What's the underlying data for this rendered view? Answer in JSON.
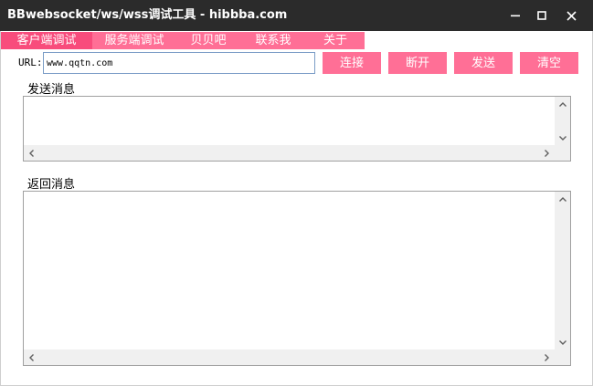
{
  "window": {
    "title": "BBwebsocket/ws/wss调试工具 - hibbba.com"
  },
  "tabs": [
    {
      "label": "客户端调试",
      "active": true
    },
    {
      "label": "服务端调试",
      "active": false
    },
    {
      "label": "贝贝吧",
      "active": false
    },
    {
      "label": "联系我",
      "active": false
    },
    {
      "label": "关于",
      "active": false
    }
  ],
  "url": {
    "label": "URL:",
    "value": "www.qqtn.com"
  },
  "buttons": {
    "connect": "连接",
    "disconnect": "断开",
    "send": "发送",
    "clear": "清空"
  },
  "send_panel": {
    "label": "发送消息",
    "content": ""
  },
  "receive_panel": {
    "label": "返回消息",
    "content": ""
  },
  "colors": {
    "titlebar": "#2b2b2b",
    "accent": "#ff6f96",
    "accent_active": "#f84c7c"
  }
}
